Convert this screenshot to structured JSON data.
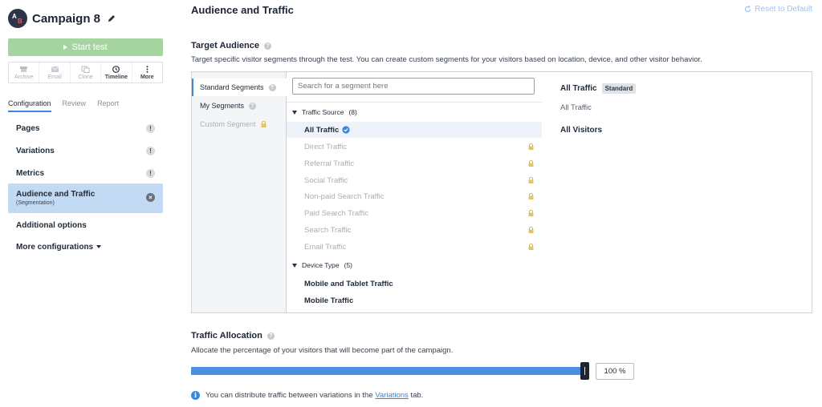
{
  "campaign": {
    "avatar_a": "A",
    "avatar_b": "B",
    "title": "Campaign 8",
    "start_label": "Start test"
  },
  "actions": [
    {
      "label": "Archive",
      "icon": "archive-icon",
      "enabled": false
    },
    {
      "label": "Email",
      "icon": "mail-icon",
      "enabled": false
    },
    {
      "label": "Clone",
      "icon": "clone-icon",
      "enabled": false
    },
    {
      "label": "Timeline",
      "icon": "clock-icon",
      "enabled": true
    },
    {
      "label": "More",
      "icon": "more-dots-icon",
      "enabled": true
    }
  ],
  "tabs": [
    {
      "label": "Configuration",
      "active": true
    },
    {
      "label": "Review"
    },
    {
      "label": "Report"
    }
  ],
  "nav": {
    "pages": "Pages",
    "variations": "Variations",
    "metrics": "Metrics",
    "audience": "Audience and Traffic",
    "audience_sub": "(Segmentation)",
    "additional": "Additional options",
    "more_config": "More configurations"
  },
  "header": {
    "title": "Audience and Traffic",
    "reset": "Reset to Default"
  },
  "target": {
    "title": "Target Audience",
    "description": "Target specific visitor segments through the test. You can create custom segments for your visitors based on location, device, and other visitor behavior."
  },
  "categories": [
    {
      "label": "Standard Segments",
      "active": true
    },
    {
      "label": "My Segments"
    },
    {
      "label": "Custom Segment",
      "locked": true
    }
  ],
  "search": {
    "placeholder": "Search for a segment here"
  },
  "groups": {
    "traffic_source": "Traffic Source",
    "traffic_source_count": "(8)",
    "device_type": "Device Type",
    "device_type_count": "(5)"
  },
  "segments": [
    {
      "label": "All Traffic",
      "selected": true
    },
    {
      "label": "Direct Traffic",
      "locked": true
    },
    {
      "label": "Referral Traffic",
      "locked": true
    },
    {
      "label": "Social Traffic",
      "locked": true
    },
    {
      "label": "Non-paid Search Traffic",
      "locked": true
    },
    {
      "label": "Paid Search Traffic",
      "locked": true
    },
    {
      "label": "Search Traffic",
      "locked": true
    },
    {
      "label": "Email Traffic",
      "locked": true
    },
    {
      "label": "Mobile and Tablet Traffic"
    },
    {
      "label": "Mobile Traffic"
    }
  ],
  "detail": {
    "title": "All Traffic",
    "badge": "Standard",
    "subtitle": "All Traffic",
    "visitors": "All Visitors"
  },
  "allocation": {
    "title": "Traffic Allocation",
    "description": "Allocate the percentage of your visitors that will become part of the campaign.",
    "value": "100 %",
    "percent": 100
  },
  "info": {
    "prefix": "You can distribute traffic between variations in the",
    "link": "Variations",
    "suffix": "tab."
  },
  "colors": {
    "accent": "#3c87d9",
    "start_button": "#a5d4a0",
    "active_nav": "#c3daf4",
    "lock": "#e3c46a"
  }
}
